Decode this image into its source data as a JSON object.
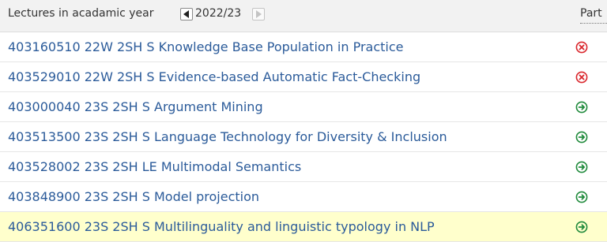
{
  "header": {
    "title": "Lectures in acadamic year",
    "year": "2022/23",
    "part_label": "Part"
  },
  "lectures": [
    {
      "label": "403160510 22W 2SH S Knowledge Base Population in Practice",
      "status_icon": "remove-circle-icon",
      "status_color": "#d9252b"
    },
    {
      "label": "403529010 22W 2SH S Evidence-based Automatic Fact-Checking",
      "status_icon": "remove-circle-icon",
      "status_color": "#d9252b"
    },
    {
      "label": "403000040 23S 2SH S Argument Mining",
      "status_icon": "arrow-circle-icon",
      "status_color": "#1f8a3b"
    },
    {
      "label": "403513500 23S 2SH S Language Technology for Diversity & Inclusion",
      "status_icon": "arrow-circle-icon",
      "status_color": "#1f8a3b"
    },
    {
      "label": "403528002 23S 2SH LE Multimodal Semantics",
      "status_icon": "arrow-circle-icon",
      "status_color": "#1f8a3b"
    },
    {
      "label": "403848900 23S 2SH S Model projection",
      "status_icon": "arrow-circle-icon",
      "status_color": "#1f8a3b"
    },
    {
      "label": "406351600 23S 2SH S Multilinguality and linguistic typology in NLP",
      "status_icon": "arrow-circle-icon",
      "status_color": "#1f8a3b",
      "highlighted": true
    }
  ],
  "colors": {
    "link": "#2b5b9a",
    "header_bg": "#f2f2f2",
    "highlight_bg": "#ffffcc"
  }
}
